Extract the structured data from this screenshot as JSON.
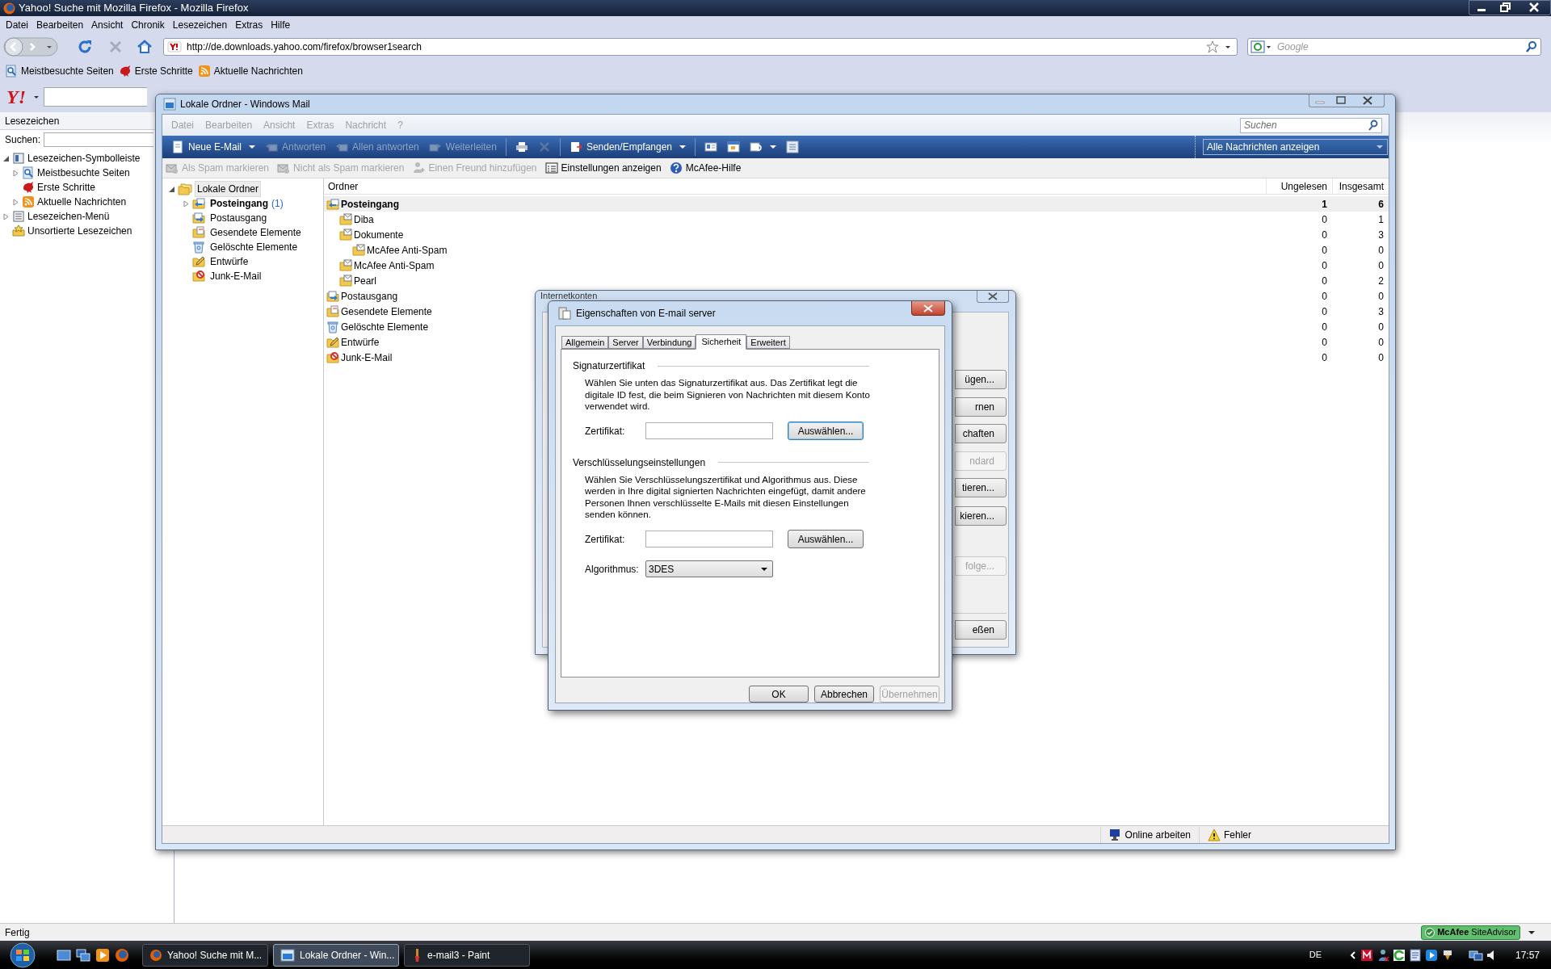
{
  "firefox": {
    "title": "Yahoo! Suche mit Mozilla Firefox - Mozilla Firefox",
    "menu": [
      "Datei",
      "Bearbeiten",
      "Ansicht",
      "Chronik",
      "Lesezeichen",
      "Extras",
      "Hilfe"
    ],
    "url": "http://de.downloads.yahoo.com/firefox/browser1search",
    "search": {
      "placeholder": "Google"
    },
    "bookmarks": [
      {
        "label": "Meistbesuchte Seiten",
        "kind": "search"
      },
      {
        "label": "Erste Schritte",
        "kind": "firefox"
      },
      {
        "label": "Aktuelle Nachrichten",
        "kind": "feed"
      }
    ],
    "yahoo_toolbar": {
      "logo": "Y!"
    },
    "sidebar": {
      "title": "Lesezeichen",
      "search_label": "Suchen:",
      "tree": [
        {
          "label": "Lesezeichen-Symbolleiste",
          "kind": "toolbar",
          "expanded": true,
          "children": [
            {
              "label": "Meistbesuchte Seiten",
              "kind": "search",
              "expanded": false
            },
            {
              "label": "Erste Schritte",
              "kind": "firefox"
            },
            {
              "label": "Aktuelle Nachrichten",
              "kind": "feed",
              "expanded": false
            }
          ]
        },
        {
          "label": "Lesezeichen-Menü",
          "kind": "menu",
          "expanded": false
        },
        {
          "label": "Unsortierte Lesezeichen",
          "kind": "unsorted"
        }
      ]
    },
    "status": "Fertig",
    "site_advisor": "**McAfee** SiteAdvisor"
  },
  "mail_window": {
    "title": "Lokale Ordner - Windows Mail",
    "menu": [
      {
        "label": "Datei",
        "disabled": true
      },
      {
        "label": "Bearbeiten",
        "disabled": true
      },
      {
        "label": "Ansicht",
        "disabled": true
      },
      {
        "label": "Extras",
        "disabled": true
      },
      {
        "label": "Nachricht",
        "disabled": true
      },
      {
        "label": "?",
        "disabled": true
      }
    ],
    "search": {
      "placeholder": "Suchen"
    },
    "toolbar": [
      {
        "label": "Neue E-Mail",
        "kind": "new",
        "disabled": false,
        "dropdown": true
      },
      {
        "label": "Antworten",
        "kind": "reply",
        "disabled": true,
        "dropdown": false
      },
      {
        "label": "Allen antworten",
        "kind": "reply-all",
        "disabled": true,
        "dropdown": false
      },
      {
        "label": "Weiterleiten",
        "kind": "forward",
        "disabled": true,
        "dropdown": false
      },
      {
        "kind": "print",
        "disabled": false,
        "dropdown": false
      },
      {
        "kind": "delete",
        "disabled": true,
        "dropdown": false
      },
      {
        "label": "Senden/Empfangen",
        "kind": "send-receive",
        "disabled": false,
        "dropdown": true
      },
      {
        "kind": "contacts",
        "disabled": false,
        "dropdown": false
      },
      {
        "kind": "calendar",
        "disabled": false,
        "dropdown": false
      },
      {
        "kind": "find",
        "disabled": false,
        "dropdown": true
      },
      {
        "kind": "layout",
        "disabled": false,
        "dropdown": false
      }
    ],
    "view_filter": "Alle Nachrichten anzeigen",
    "toolbar2": [
      {
        "label": "Als Spam markieren",
        "kind": "spam",
        "disabled": true
      },
      {
        "label": "Nicht als Spam markieren",
        "kind": "not-spam",
        "disabled": true
      },
      {
        "label": "Einen Freund hinzufügen",
        "kind": "friend",
        "disabled": true
      },
      {
        "label": "Einstellungen anzeigen",
        "kind": "settings",
        "disabled": false
      },
      {
        "label": "McAfee-Hilfe",
        "kind": "help",
        "disabled": false
      }
    ],
    "folders": [
      {
        "label": "Lokale Ordner",
        "kind": "local",
        "expanded": true,
        "bold": false,
        "selected": true,
        "children": [
          {
            "label": "Posteingang",
            "count": "(1)",
            "kind": "inbox",
            "expanded": false,
            "bold": true,
            "selected": false
          },
          {
            "label": "Postausgang",
            "kind": "outbox",
            "bold": false,
            "selected": false
          },
          {
            "label": "Gesendete Elemente",
            "kind": "sent",
            "bold": false,
            "selected": false
          },
          {
            "label": "Gelöschte Elemente",
            "kind": "deleted",
            "bold": false,
            "selected": false
          },
          {
            "label": "Entwürfe",
            "kind": "drafts",
            "bold": false,
            "selected": false
          },
          {
            "label": "Junk-E-Mail",
            "kind": "junk",
            "bold": false,
            "selected": false
          }
        ]
      }
    ],
    "folder_list": {
      "columns": [
        "Ordner",
        "Ungelesen",
        "Insgesamt"
      ],
      "rows": [
        {
          "name": "Posteingang",
          "kind": "inbox",
          "unread": "1",
          "total": "6",
          "bold": true,
          "selected": true,
          "children": [
            {
              "name": "Diba",
              "kind": "folder",
              "unread": "0",
              "total": "1",
              "bold": false,
              "selected": false
            },
            {
              "name": "Dokumente",
              "kind": "folder",
              "unread": "0",
              "total": "3",
              "bold": false,
              "selected": false,
              "children": [
                {
                  "name": "McAfee Anti-Spam",
                  "kind": "folder",
                  "unread": "0",
                  "total": "0",
                  "bold": false,
                  "selected": false
                }
              ]
            },
            {
              "name": "McAfee Anti-Spam",
              "kind": "folder",
              "unread": "0",
              "total": "0",
              "bold": false,
              "selected": false
            },
            {
              "name": "Pearl",
              "kind": "folder",
              "unread": "0",
              "total": "2",
              "bold": false,
              "selected": false
            }
          ]
        },
        {
          "name": "Postausgang",
          "kind": "outbox",
          "unread": "0",
          "total": "0",
          "bold": false,
          "selected": false
        },
        {
          "name": "Gesendete Elemente",
          "kind": "sent",
          "unread": "0",
          "total": "3",
          "bold": false,
          "selected": false
        },
        {
          "name": "Gelöschte Elemente",
          "kind": "deleted",
          "unread": "0",
          "total": "0",
          "bold": false,
          "selected": false
        },
        {
          "name": "Entwürfe",
          "kind": "drafts",
          "unread": "0",
          "total": "0",
          "bold": false,
          "selected": false
        },
        {
          "name": "Junk-E-Mail",
          "kind": "junk",
          "unread": "0",
          "total": "0",
          "bold": false,
          "selected": false
        }
      ]
    },
    "status": [
      {
        "label": "Online arbeiten",
        "kind": "online"
      },
      {
        "label": "Fehler",
        "kind": "warning"
      }
    ]
  },
  "accounts_dialog": {
    "title": "Internetkonten",
    "buttons": [
      {
        "label": "ügen...",
        "disabled": false
      },
      {
        "label": "rnen",
        "disabled": false
      },
      {
        "label": "chaften",
        "disabled": false
      },
      {
        "label": "ndard",
        "disabled": true
      },
      {
        "label": "tieren...",
        "disabled": false
      },
      {
        "label": "kieren...",
        "disabled": false
      },
      {
        "label": "folge...",
        "disabled": true
      },
      {
        "label": "eßen",
        "disabled": false
      }
    ]
  },
  "properties_dialog": {
    "title": "Eigenschaften von E-mail server",
    "tabs": [
      {
        "label": "Allgemein",
        "selected": false
      },
      {
        "label": "Server",
        "selected": false
      },
      {
        "label": "Verbindung",
        "selected": false
      },
      {
        "label": "Sicherheit",
        "selected": true
      },
      {
        "label": "Erweitert",
        "selected": false
      }
    ],
    "sections": [
      {
        "title": "Signaturzertifikat",
        "description": "Wählen Sie unten das Signaturzertifikat aus. Das Zertifikat legt die digitale ID fest, die beim Signieren von Nachrichten mit diesem Konto verwendet wird.",
        "certificate_label": "Zertifikat:",
        "choose_button": {
          "label": "Auswählen...",
          "default": true
        }
      },
      {
        "title": "Verschlüsselungseinstellungen",
        "description": "Wählen Sie Verschlüsselungszertifikat und Algorithmus aus. Diese werden in Ihre digital signierten Nachrichten eingefügt, damit andere Personen Ihnen verschlüsselte E-Mails mit diesen Einstellungen senden können.",
        "certificate_label": "Zertifikat:",
        "choose_button": {
          "label": "Auswählen...",
          "default": false
        },
        "algorithm": {
          "label": "Algorithmus:",
          "value": "3DES"
        }
      }
    ],
    "buttons": [
      {
        "label": "OK",
        "disabled": false
      },
      {
        "label": "Abbrechen",
        "disabled": false
      },
      {
        "label": "Übernehmen",
        "disabled": true
      }
    ]
  },
  "taskbar": {
    "tasks": [
      {
        "label": "Yahoo! Suche mit M...",
        "kind": "firefox",
        "selected": false
      },
      {
        "label": "Lokale Ordner - Win...",
        "kind": "mail",
        "selected": true
      },
      {
        "label": "e-mail3 - Paint",
        "kind": "paint",
        "selected": false
      }
    ],
    "language": "DE",
    "clock": "17:57"
  }
}
